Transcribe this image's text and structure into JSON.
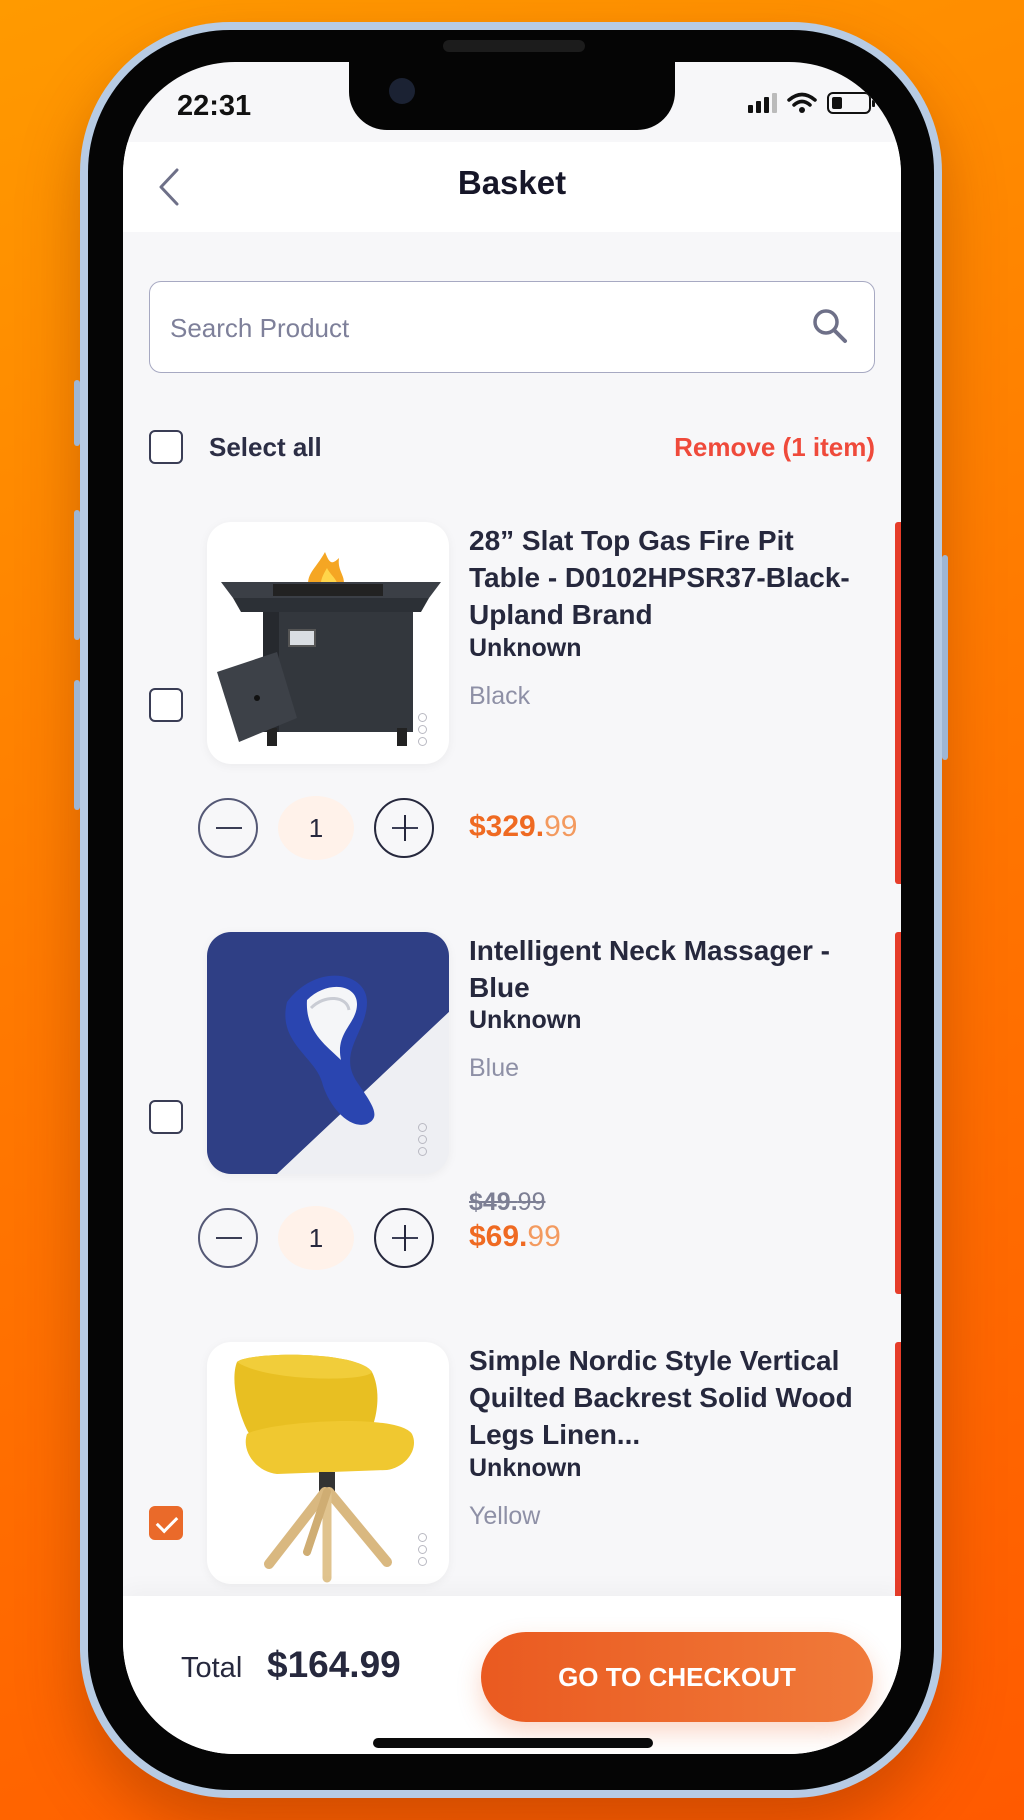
{
  "status_bar": {
    "time": "22:31"
  },
  "header": {
    "title": "Basket"
  },
  "search": {
    "placeholder": "Search Product"
  },
  "selection": {
    "select_all_label": "Select all",
    "remove_label": "Remove (1 item)"
  },
  "items": [
    {
      "name": "28” Slat Top Gas Fire Pit Table - D0102HPSR37-Black-Upland Brand",
      "brand": "Unknown",
      "color": "Black",
      "quantity": "1",
      "price_main": "$329.",
      "price_cents": "99",
      "checked": false
    },
    {
      "name": "Intelligent Neck Massager - Blue",
      "brand": "Unknown",
      "color": "Blue",
      "quantity": "1",
      "old_price_main": "$49.",
      "old_price_cents": "99",
      "price_main": "$69.",
      "price_cents": "99",
      "checked": false
    },
    {
      "name": "Simple Nordic Style Vertical Quilted Backrest Solid Wood Legs Linen...",
      "brand": "Unknown",
      "color": "Yellow",
      "checked": true
    }
  ],
  "footer": {
    "total_label": "Total",
    "total_value": "$164.99",
    "checkout_label": "GO TO CHECKOUT"
  },
  "colors": {
    "accent": "#ea6a2a",
    "remove": "#ef4a3b",
    "text": "#26283d",
    "edge": "#e63d2a"
  }
}
